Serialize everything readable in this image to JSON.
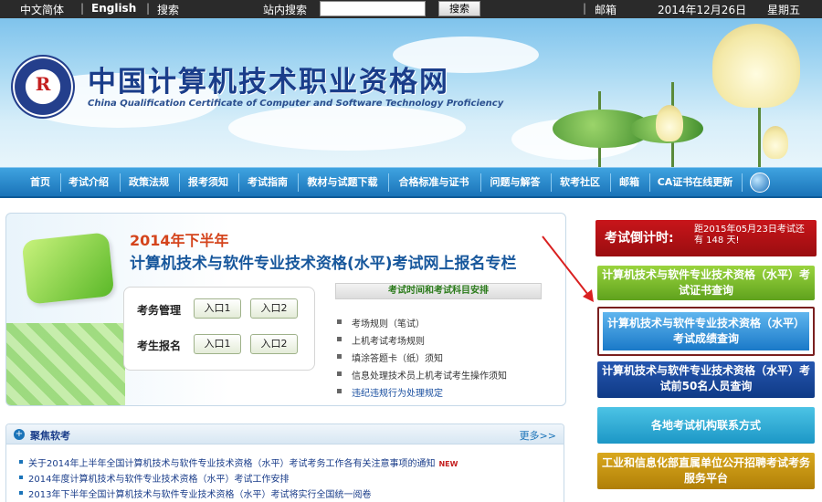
{
  "topbar": {
    "lang_simplified": "中文简体",
    "lang_english": "English",
    "search_link": "搜索",
    "site_search_label": "站内搜索",
    "search_input_value": "",
    "search_button": "搜索",
    "mail": "邮箱",
    "date": "2014年12月26日",
    "weekday": "星期五"
  },
  "banner": {
    "title": "中国计算机技术职业资格网",
    "subtitle": "China Qualification Certificate of Computer and Software Technology Proficiency"
  },
  "nav": {
    "items": [
      {
        "label": "首页"
      },
      {
        "label": "考试介绍"
      },
      {
        "label": "政策法规"
      },
      {
        "label": "报考须知"
      },
      {
        "label": "考试指南"
      },
      {
        "label": "教材与试题下载"
      },
      {
        "label": "合格标准与证书"
      },
      {
        "label": "问题与解答"
      },
      {
        "label": "软考社区"
      },
      {
        "label": "邮箱"
      },
      {
        "label": "CA证书在线更新"
      }
    ]
  },
  "main": {
    "year_title": "2014年下半年",
    "reg_title": "计算机技术与软件专业技术资格(水平)考试网上报名专栏",
    "exam_admin_label": "考务管理",
    "candidate_label": "考生报名",
    "entry1": "入口1",
    "entry2": "入口2",
    "schedule_tab": "考试时间和考试科目安排",
    "rules": [
      "考场规则（笔试）",
      "上机考试考场规则",
      "填涂答题卡（纸）须知",
      "信息处理技术员上机考试考生操作须知",
      "违纪违规行为处理规定"
    ]
  },
  "sidebar": {
    "countdown_label": "考试倒计时:",
    "countdown_text": "距2015年05月23日考试还有 148 天!",
    "cert_query": "计算机技术与软件专业技术资格（水平）考试证书查询",
    "score_query": "计算机技术与软件专业技术资格（水平）考试成绩查询",
    "top50_query": "计算机技术与软件专业技术资格（水平）考试前50名人员查询",
    "contacts": "各地考试机构联系方式",
    "recruit": "工业和信息化部直属单位公开招聘考试考务服务平台"
  },
  "news": {
    "title": "聚焦软考",
    "more": "更多>>",
    "new_badge": "NEW",
    "items": [
      "关于2014年上半年全国计算机技术与软件专业技术资格（水平）考试考务工作各有关注意事项的通知",
      "2014年度计算机技术与软件专业技术资格（水平）考试工作安排",
      "2013年下半年全国计算机技术与软件专业技术资格（水平）考试将实行全国统一阅卷"
    ]
  }
}
